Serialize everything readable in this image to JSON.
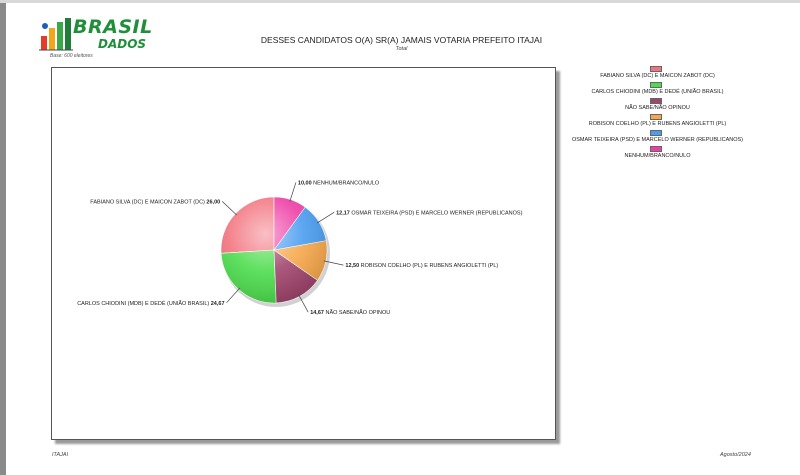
{
  "logo": {
    "word1": "BRASIL",
    "word2": "DADOS",
    "sub": "Base: 600 eleitores"
  },
  "header": {
    "title": "DESSES CANDIDATOS O(A) SR(A) JAMAIS VOTARIA PREFEITO ITAJAI",
    "subtitle": "Total"
  },
  "footer": {
    "left": "ITAJAI",
    "right": "Agosto/2024"
  },
  "chart_data": {
    "type": "pie",
    "title": "DESSES CANDIDATOS O(A) SR(A) JAMAIS VOTARIA PREFEITO ITAJAI",
    "subtitle": "Total",
    "legend_position": "right",
    "slices": [
      {
        "label": "FABIANO SILVA (DC) E MAICON ZABOT (DC)",
        "value": 26.0,
        "value_text": "26,00",
        "color": "#f2737e"
      },
      {
        "label": "CARLOS CHIODINI (MDB) E DEDÉ (UNIÃO BRASIL)",
        "value": 24.67,
        "value_text": "24,67",
        "color": "#4ddc4d"
      },
      {
        "label": "NÃO SABE/NÃO OPINOU",
        "value": 14.67,
        "value_text": "14,67",
        "color": "#a0456d"
      },
      {
        "label": "ROBISON COELHO (PL) E RUBENS ANGIOLETTI (PL)",
        "value": 12.5,
        "value_text": "12,50",
        "color": "#f7a84b"
      },
      {
        "label": "OSMAR TEIXEIRA (PSD) E MARCELO WERNER (REPUBLICANOS)",
        "value": 12.17,
        "value_text": "12,17",
        "color": "#4b9df0"
      },
      {
        "label": "NENHUM/BRANCO/NULO",
        "value": 10.0,
        "value_text": "10,00",
        "color": "#ee3fa6"
      }
    ]
  }
}
